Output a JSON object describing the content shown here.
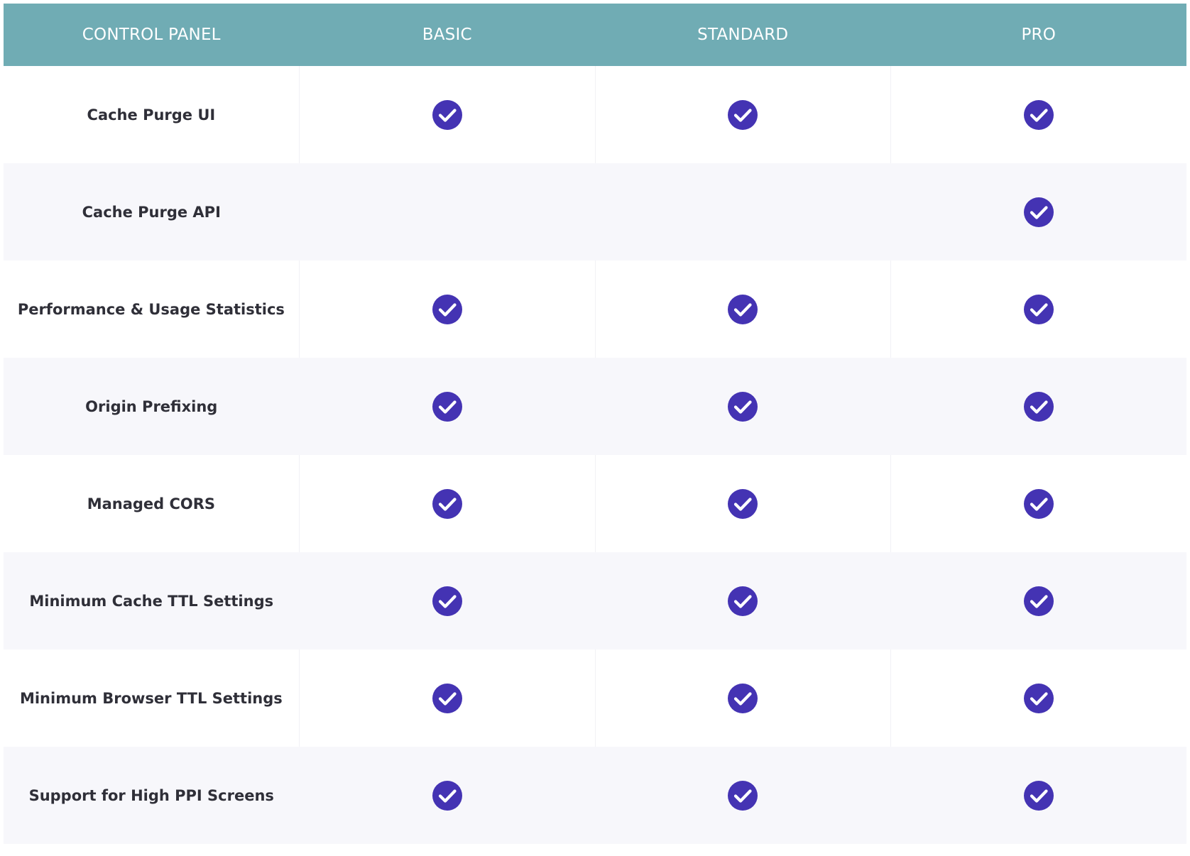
{
  "colors": {
    "header_bg": "#70acb4",
    "check_fill": "#4433b3",
    "row_alt_bg": "#f7f7fb",
    "text": "#2f2f38"
  },
  "header": {
    "columns": [
      "CONTROL PANEL",
      "BASIC",
      "STANDARD",
      "PRO"
    ]
  },
  "rows": [
    {
      "feature": "Cache Purge UI",
      "basic": true,
      "standard": true,
      "pro": true
    },
    {
      "feature": "Cache Purge API",
      "basic": false,
      "standard": false,
      "pro": true
    },
    {
      "feature": "Performance & Usage Statistics",
      "basic": true,
      "standard": true,
      "pro": true
    },
    {
      "feature": "Origin Prefixing",
      "basic": true,
      "standard": true,
      "pro": true
    },
    {
      "feature": "Managed CORS",
      "basic": true,
      "standard": true,
      "pro": true
    },
    {
      "feature": "Minimum Cache TTL Settings",
      "basic": true,
      "standard": true,
      "pro": true
    },
    {
      "feature": "Minimum Browser TTL Settings",
      "basic": true,
      "standard": true,
      "pro": true
    },
    {
      "feature": "Support for High PPI Screens",
      "basic": true,
      "standard": true,
      "pro": true
    }
  ],
  "icons": {
    "included": "check-circle-icon"
  }
}
